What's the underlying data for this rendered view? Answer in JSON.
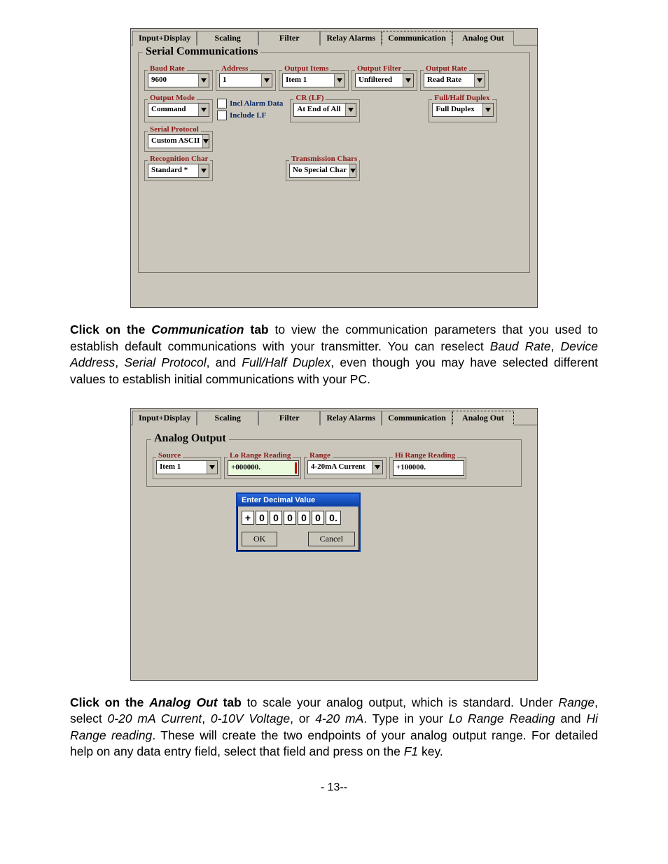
{
  "panel1": {
    "tabs": [
      "Input+Display",
      "Scaling",
      "Filter",
      "Relay Alarms",
      "Communication",
      "Analog Out"
    ],
    "active_tab": "Communication",
    "group_title": "Serial Communications",
    "baud_rate": {
      "label": "Baud Rate",
      "value": "9600"
    },
    "address": {
      "label": "Address",
      "value": "1"
    },
    "output_items": {
      "label": "Output Items",
      "value": "Item 1"
    },
    "output_filter": {
      "label": "Output Filter",
      "value": "Unfiltered"
    },
    "output_rate": {
      "label": "Output Rate",
      "value": "Read Rate"
    },
    "output_mode": {
      "label": "Output Mode",
      "value": "Command"
    },
    "chk1": "Incl Alarm Data",
    "chk2": "Include LF",
    "crlf": {
      "label": "CR (LF)",
      "value": "At End of All"
    },
    "duplex": {
      "label": "Full/Half Duplex",
      "value": "Full Duplex"
    },
    "serial_protocol": {
      "label": "Serial Protocol",
      "value": "Custom ASCII"
    },
    "recognition": {
      "label": "Recognition Char",
      "value": "Standard *"
    },
    "transmission": {
      "label": "Transmission Chars",
      "value": "No Special Char"
    }
  },
  "instr1": {
    "lead_bold": "Click on the ",
    "lead_ital": "Communication",
    "lead_bold2": " tab",
    "rest1": " to view the communication parameters that you used to establish default communications with your transmitter. You can reselect ",
    "i1": "Baud Rate",
    "c1": ", ",
    "i2": "Device Address",
    "c2": ", ",
    "i3": "Serial Protocol",
    "c3": ", and ",
    "i4": "Full/Half Duplex",
    "rest2": ", even though you may have selected different values to establish initial communications with your PC."
  },
  "panel2": {
    "tabs": [
      "Input+Display",
      "Scaling",
      "Filter",
      "Relay Alarms",
      "Communication",
      "Analog Out"
    ],
    "active_tab": "Analog Out",
    "group_title": "Analog Output",
    "source": {
      "label": "Source",
      "value": "Item 1"
    },
    "lo_range": {
      "label": "Lo Range Reading",
      "value": "+000000."
    },
    "range": {
      "label": "Range",
      "value": "4-20mA Current"
    },
    "hi_range": {
      "label": "Hi Range Reading",
      "value": "+100000."
    },
    "dialog": {
      "title": "Enter Decimal Value",
      "digits": [
        "+",
        "0",
        "0",
        "0",
        "0",
        "0",
        "0."
      ],
      "ok": "OK",
      "cancel": "Cancel"
    }
  },
  "instr2": {
    "lead_bold": "Click on the ",
    "lead_ital": "Analog Out",
    "lead_bold2": " tab",
    "rest1": " to scale your analog output, which is standard. Under ",
    "i1": "Range",
    "rest2": ", select ",
    "i2": "0-20 mA Current",
    "c1": ", ",
    "i3": "0-10V Voltage",
    "c2": ", or ",
    "i4": "4-20 mA",
    "rest3": ". Type in your ",
    "i5": "Lo Range Reading",
    "c3": " and ",
    "i6": "Hi Range reading",
    "rest4": ". These will create the two endpoints of your analog output range. For detailed help on any data entry field, select that field and press on the ",
    "i7": "F1",
    "rest5": " key."
  },
  "page_number": "- 13--"
}
